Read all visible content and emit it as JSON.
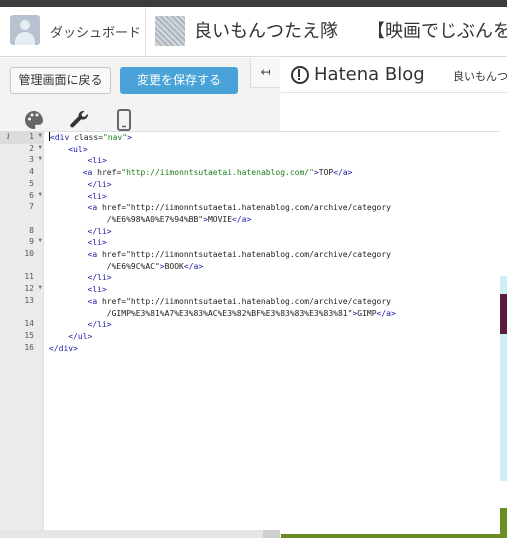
{
  "header": {
    "dashboard_label": "ダッシュボード",
    "blog_title": "良いもんつたえ隊",
    "post_title": "【映画でじぶんを変"
  },
  "editor_panel": {
    "back_button": "管理画面に戻る",
    "save_button": "変更を保存する",
    "collapse_glyph": "↤",
    "tools": [
      "palette-icon",
      "wrench-icon",
      "mobile-icon"
    ]
  },
  "code": {
    "lines": [
      {
        "num": "1",
        "fold": true,
        "text": "<div class=\"nav\">"
      },
      {
        "num": "2",
        "fold": true,
        "text": "    <ul>"
      },
      {
        "num": "3",
        "fold": true,
        "text": "        <li>"
      },
      {
        "num": "4",
        "fold": false,
        "text": "       <a href=\"http://iimonntsutaetai.hatenablog.com/\">TOP</a>"
      },
      {
        "num": "5",
        "fold": false,
        "text": "        </li>"
      },
      {
        "num": "6",
        "fold": true,
        "text": "        <li>"
      },
      {
        "num": "7",
        "fold": false,
        "text": "        <a href=\"http://iimonntsutaetai.hatenablog.com/archive/category"
      },
      {
        "num": "",
        "fold": false,
        "text": "            /%E6%98%A0%E7%94%BB\">MOVIE</a>"
      },
      {
        "num": "8",
        "fold": false,
        "text": "        </li>"
      },
      {
        "num": "9",
        "fold": true,
        "text": "        <li>"
      },
      {
        "num": "10",
        "fold": false,
        "text": "        <a href=\"http://iimonntsutaetai.hatenablog.com/archive/category"
      },
      {
        "num": "",
        "fold": false,
        "text": "            /%E6%9C%AC\">BOOK</a>"
      },
      {
        "num": "11",
        "fold": false,
        "text": "        </li>"
      },
      {
        "num": "12",
        "fold": true,
        "text": "        <li>"
      },
      {
        "num": "13",
        "fold": false,
        "text": "        <a href=\"http://iimonntsutaetai.hatenablog.com/archive/category"
      },
      {
        "num": "",
        "fold": false,
        "text": "            /GIMP%E3%81%A7%E3%83%AC%E3%82%BF%E3%83%83%E3%83%81\">GIMP</a>"
      },
      {
        "num": "14",
        "fold": false,
        "text": "        </li>"
      },
      {
        "num": "15",
        "fold": false,
        "text": "    </ul>"
      },
      {
        "num": "16",
        "fold": false,
        "text": "</div>"
      }
    ]
  },
  "preview": {
    "brand": "Hatena Blog",
    "blog_title": "良いもんつ"
  }
}
